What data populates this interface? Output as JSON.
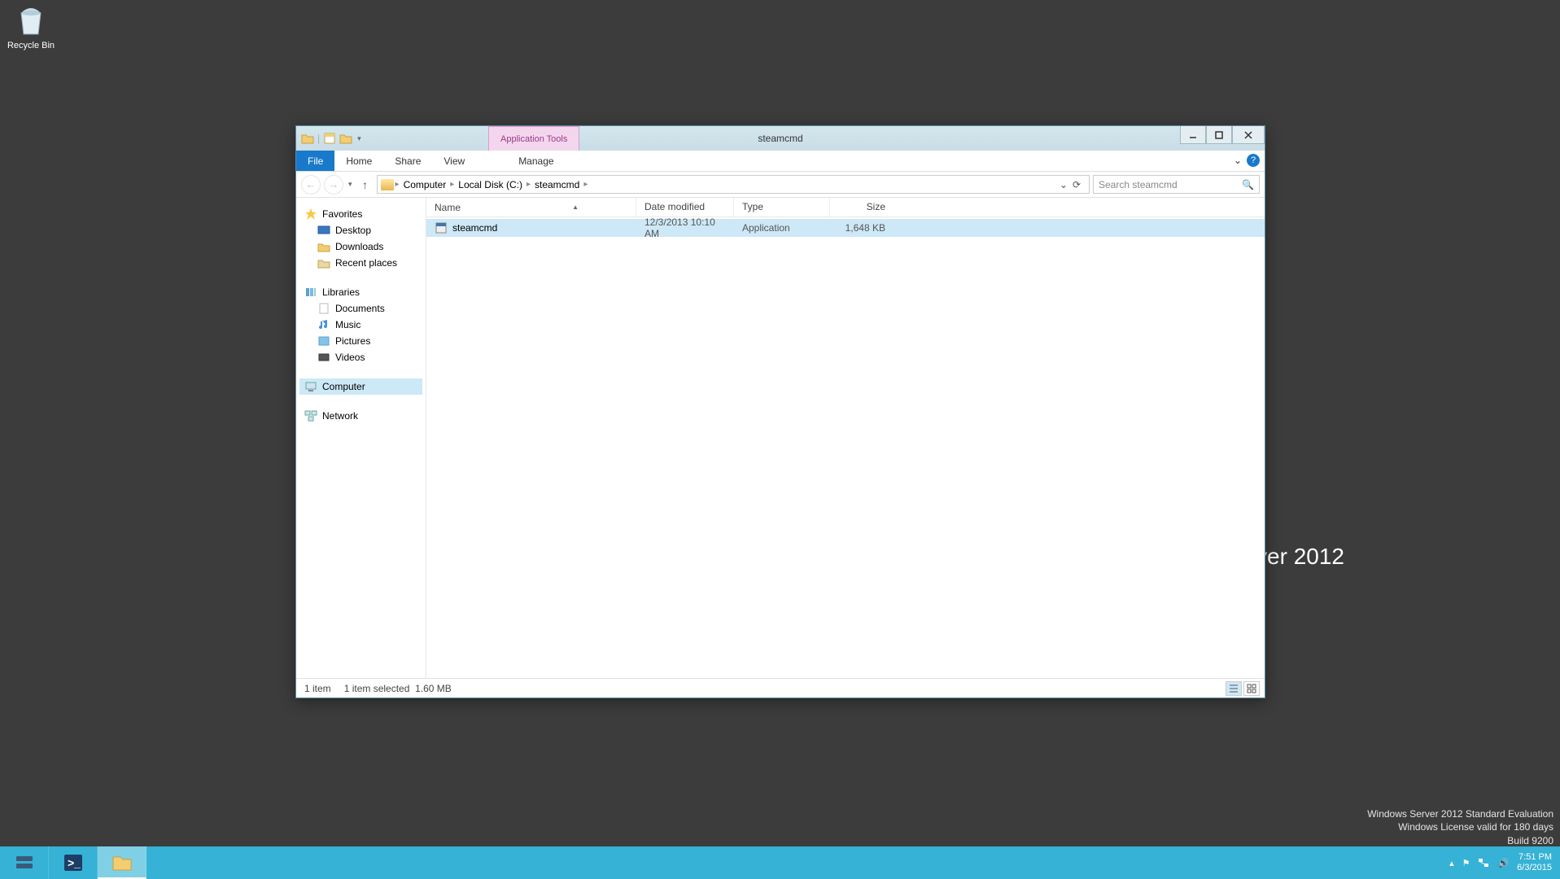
{
  "desktop": {
    "recycle_bin": "Recycle Bin"
  },
  "watermark": {
    "logo_text": "Windows Server 2012",
    "line1": "Windows Server 2012 Standard Evaluation",
    "line2": "Windows License valid for 180 days",
    "line3": "Build 9200"
  },
  "window": {
    "title": "steamcmd",
    "context_tab": "Application Tools",
    "ribbon": {
      "file": "File",
      "home": "Home",
      "share": "Share",
      "view": "View",
      "manage": "Manage"
    },
    "breadcrumbs": [
      "Computer",
      "Local Disk (C:)",
      "steamcmd"
    ],
    "search_placeholder": "Search steamcmd",
    "columns": {
      "name": "Name",
      "date": "Date modified",
      "type": "Type",
      "size": "Size"
    },
    "rows": [
      {
        "name": "steamcmd",
        "date": "12/3/2013 10:10 AM",
        "type": "Application",
        "size": "1,648 KB"
      }
    ],
    "sidebar": {
      "favorites": "Favorites",
      "fav_items": [
        "Desktop",
        "Downloads",
        "Recent places"
      ],
      "libraries": "Libraries",
      "lib_items": [
        "Documents",
        "Music",
        "Pictures",
        "Videos"
      ],
      "computer": "Computer",
      "network": "Network"
    },
    "status": {
      "count": "1 item",
      "selected": "1 item selected",
      "size": "1.60 MB"
    }
  },
  "taskbar": {
    "time": "7:51 PM",
    "date": "6/3/2015"
  }
}
